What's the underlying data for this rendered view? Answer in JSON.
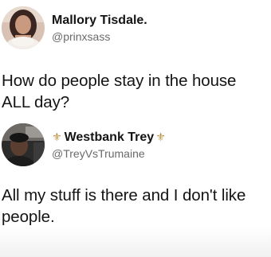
{
  "tweets": [
    {
      "display_name": "Mallory Tisdale.",
      "handle": "@prinxsass",
      "text": "How do people stay in the house ALL day?",
      "avatar_icon": "profile-photo-woman"
    },
    {
      "display_name": "Westbank Trey",
      "handle": "@TreyVsTrumaine",
      "text": "All my stuff is there and I don't like people.",
      "avatar_icon": "profile-photo-man-in-car",
      "name_decoration": "fleur-de-lis-icon",
      "fleur_glyph": "⚜"
    }
  ],
  "colors": {
    "name": "#141414",
    "handle": "#6a6a6a",
    "fleur": "#b89442"
  }
}
